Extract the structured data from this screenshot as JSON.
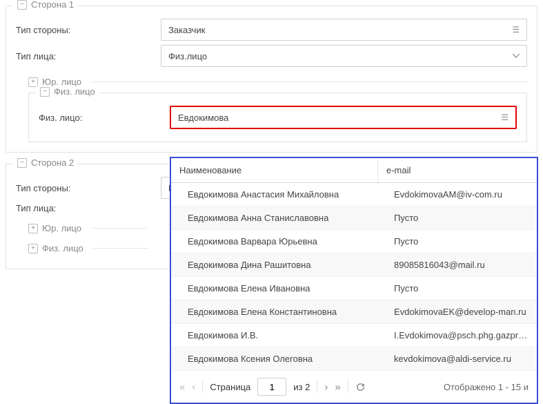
{
  "side1": {
    "legend": "Сторона 1",
    "type_label": "Тип стороны:",
    "type_value": "Заказчик",
    "person_type_label": "Тип лица:",
    "person_type_value": "Физ.лицо",
    "sub_legal": "Юр. лицо",
    "sub_phys": "Физ. лицо",
    "phys_label": "Физ. лицо:",
    "phys_value": "Евдокимова"
  },
  "side2": {
    "legend": "Сторона 2",
    "type_label": "Тип стороны:",
    "type_value": "И",
    "person_type_label": "Тип лица:",
    "sub_legal": "Юр. лицо",
    "sub_phys": "Физ. лицо"
  },
  "dropdown": {
    "col_name": "Наименование",
    "col_email": "e-mail",
    "rows": [
      {
        "name": "Евдокимова Анастасия Михайловна",
        "email": "EvdokimovaAM@iv-com.ru"
      },
      {
        "name": "Евдокимова Анна Станиславовна",
        "email": "Пусто"
      },
      {
        "name": "Евдокимова Варвара Юрьевна",
        "email": "Пусто"
      },
      {
        "name": "Евдокимова Дина Рашитовна",
        "email": "89085816043@mail.ru"
      },
      {
        "name": "Евдокимова Елена Ивановна",
        "email": "Пусто"
      },
      {
        "name": "Евдокимова Елена Константиновна",
        "email": "EvdokimovaEK@develop-man.ru"
      },
      {
        "name": "Евдокимова И.В.",
        "email": "I.Evdokimova@psch.phg.gazprom.ru"
      },
      {
        "name": "Евдокимова Ксения Олеговна",
        "email": "kevdokimova@aldi-service.ru"
      }
    ],
    "pager": {
      "page_label": "Страница",
      "page": "1",
      "of": "из 2",
      "info": "Отображено 1 - 15 и"
    }
  }
}
